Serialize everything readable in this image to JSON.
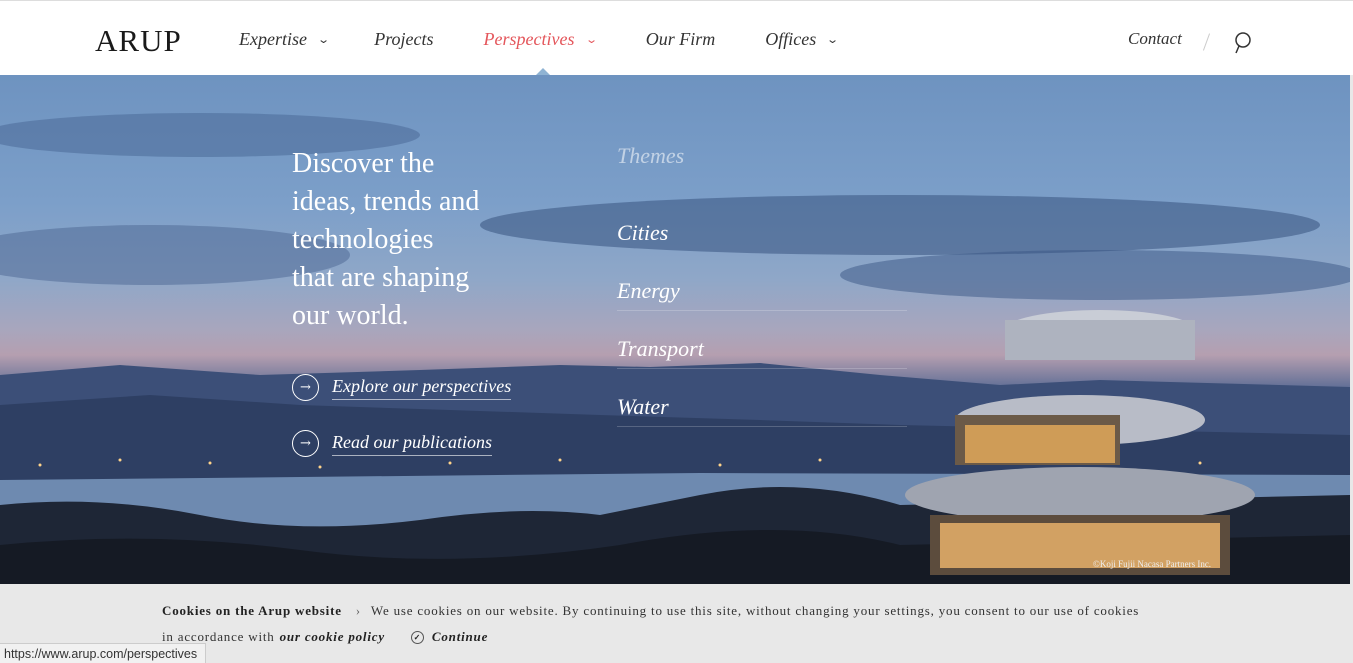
{
  "header": {
    "logo": "ARUP",
    "nav": [
      {
        "label": "Expertise",
        "has_dropdown": true
      },
      {
        "label": "Projects",
        "has_dropdown": false
      },
      {
        "label": "Perspectives",
        "has_dropdown": true,
        "active": true
      },
      {
        "label": "Our Firm",
        "has_dropdown": false
      },
      {
        "label": "Offices",
        "has_dropdown": true
      }
    ],
    "contact": "Contact",
    "search_icon": "search-icon",
    "chevron": "⌄"
  },
  "hero": {
    "headline": [
      "Discover the",
      "ideas, trends and",
      "technologies",
      "that are shaping",
      "our world."
    ],
    "cta_explore": "Explore our perspectives",
    "cta_publications": "Read our publications",
    "cta_arrow": "→",
    "themes_heading": "Themes",
    "themes": [
      "Cities",
      "Energy",
      "Transport",
      "Water"
    ],
    "credit": "©Koji Fujii Nacasa Partners Inc."
  },
  "cookie": {
    "title": "Cookies on the Arup website",
    "separator": "›",
    "message_1": "We use cookies on our website. By continuing to use this site, without changing your settings, you consent to our use of cookies",
    "message_2": "in accordance with",
    "policy_link": "our cookie policy",
    "continue_label": "Continue",
    "check_glyph": "✓"
  },
  "status_bar": {
    "url": "https://www.arup.com/perspectives"
  },
  "colors": {
    "accent": "#e4565b",
    "text": "#333333",
    "cookie_bg": "#e8e8e8"
  }
}
